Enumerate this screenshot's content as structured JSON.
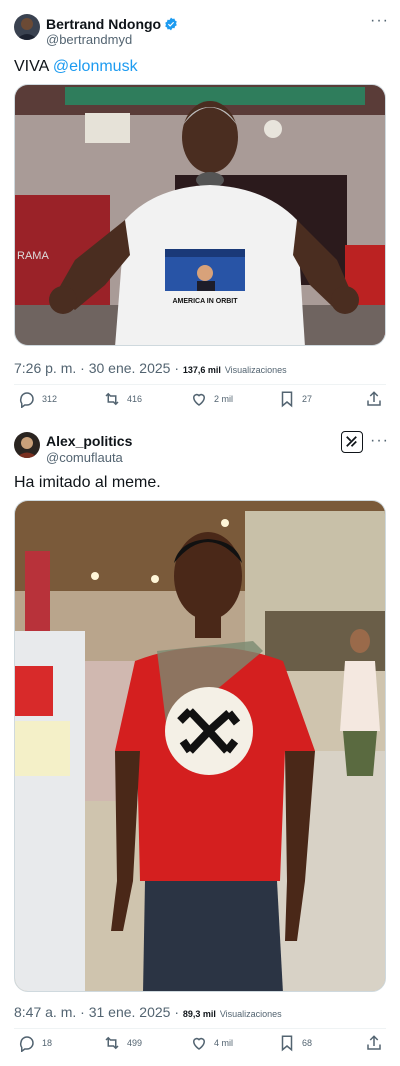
{
  "posts": [
    {
      "author_name": "Bertrand Ndongo",
      "author_handle": "@bertrandmyd",
      "verified": true,
      "text_prefix": "VIVA ",
      "text_mention": "@elonmusk",
      "image": {
        "shirt_text": "AMERICA IN ORBIT",
        "tv_text": "RAMA"
      },
      "timestamp": "7:26 p. m. · 30 ene. 2025 · ",
      "views_count": "137,6 mil",
      "views_label": "Visualizaciones",
      "replies": "312",
      "reposts": "416",
      "likes": "2 mil",
      "bookmarks": "27"
    },
    {
      "author_name": "Alex_politics",
      "author_handle": "@comuflauta",
      "text": "Ha imitado al meme.",
      "timestamp": "8:47 a. m. · 31 ene. 2025 · ",
      "views_count": "89,3 mil",
      "views_label": "Visualizaciones",
      "replies": "18",
      "reposts": "499",
      "likes": "4 mil",
      "bookmarks": "68"
    }
  ],
  "colors": {
    "accent": "#1d9bf0",
    "muted": "#536471",
    "divider": "#eff3f4"
  }
}
